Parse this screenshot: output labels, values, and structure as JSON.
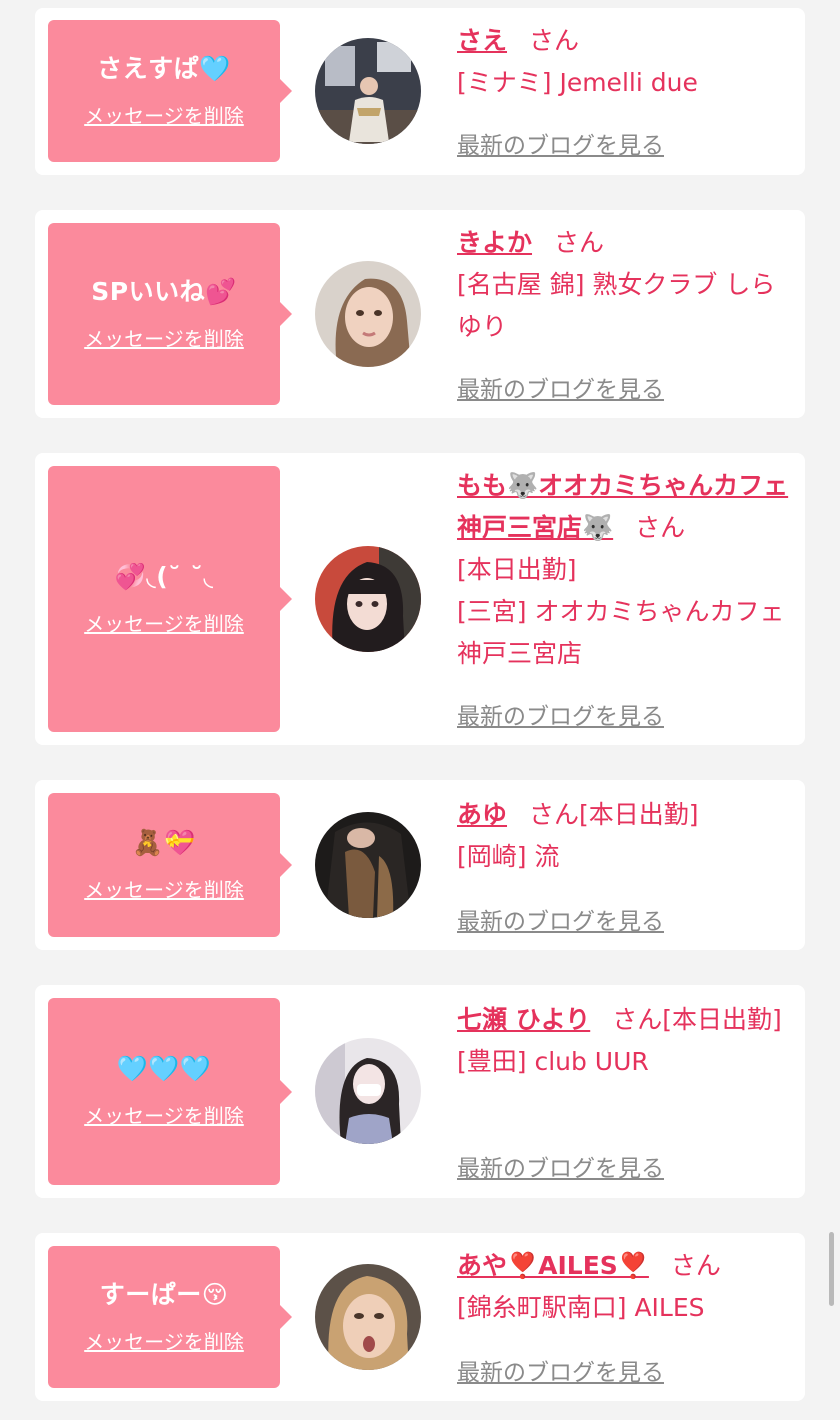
{
  "common": {
    "delete_label": "メッセージを削除",
    "blog_label": "最新のブログを見る",
    "san": "さん"
  },
  "messages": [
    {
      "message": "さえすぱ🩵",
      "name": "さえ",
      "info_lines": [
        "[ミナミ] Jemelli due"
      ]
    },
    {
      "message": "SPいいね💕",
      "name": "きよか",
      "info_lines": [
        "[名古屋 錦] 熟女クラブ しらゆり"
      ]
    },
    {
      "message": "💞◟(˘ ˘◟",
      "name": "もも🐺オオカミちゃんカフェ神戸三宮店🐺",
      "info_lines": [
        "[本日出勤]",
        "[三宮] オオカミちゃんカフェ神戸三宮店"
      ]
    },
    {
      "message": "🧸💝",
      "name": "あゆ",
      "name_suffix": "[本日出勤]",
      "info_lines": [
        "[岡崎] 流"
      ]
    },
    {
      "message": "🩵🩵🩵",
      "name": "七瀬 ひより",
      "name_suffix": "[本日出勤]",
      "info_lines": [
        "[豊田] club UUR"
      ]
    },
    {
      "message": "すーぱー😚",
      "name": "あや❣️AILES❣️",
      "info_lines": [
        "[錦糸町駅南口] AILES"
      ]
    }
  ],
  "colors": {
    "accent": "#e5325c",
    "bubble": "#fb8a9c",
    "link_gray": "#8a8a8a",
    "background": "#f3f3f3"
  }
}
